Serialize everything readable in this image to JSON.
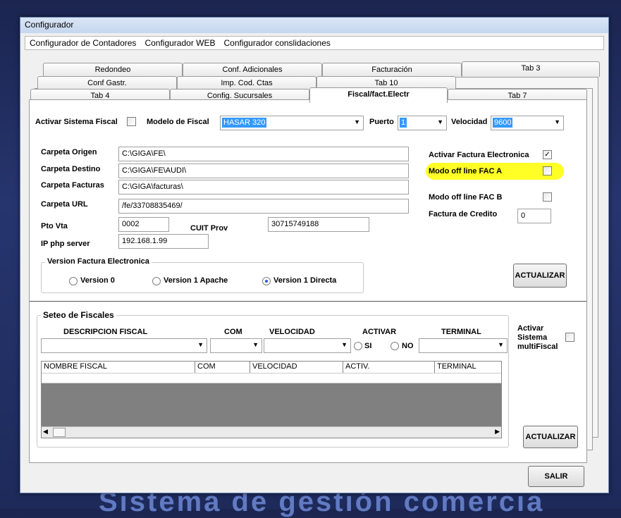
{
  "background_text": "Sistema de gestión comercia",
  "window": {
    "title": "Configurador"
  },
  "menu": [
    "Configurador de Contadores",
    "Configurador WEB",
    "Configurador conslidaciones"
  ],
  "tabs": {
    "row1": [
      "Redondeo",
      "Conf. Adicionales",
      "Facturación",
      "Tab 3"
    ],
    "row2": [
      "Conf Gastr.",
      "Imp. Cod. Ctas",
      "Tab 10"
    ],
    "row3": [
      "Tab 4",
      "Config. Sucursales",
      "Fiscal/fact.Electr",
      "Tab 7"
    ]
  },
  "fiscal": {
    "activar_label": "Activar Sistema Fiscal",
    "modelo_label": "Modelo de Fiscal",
    "modelo_value": "HASAR 320",
    "puerto_label": "Puerto",
    "puerto_value": "1",
    "velocidad_label": "Velocidad",
    "velocidad_value": "9600"
  },
  "fe": {
    "origen_label": "Carpeta Origen",
    "origen_value": "C:\\GIGA\\FE\\",
    "destino_label": "Carpeta Destino",
    "destino_value": "C:\\GIGA\\FE\\AUDI\\",
    "facturas_label": "Carpeta Facturas",
    "facturas_value": "C:\\GIGA\\facturas\\",
    "url_label": "Carpeta URL",
    "url_value": "/fe/33708835469/",
    "ptovta_label": "Pto Vta",
    "ptovta_value": "0002",
    "cuit_label": "CUIT Prov",
    "cuit_value": "30715749188",
    "ip_label": "IP php server",
    "ip_value": "192.168.1.99",
    "activar_fe_label": "Activar Factura Electronica",
    "activar_fe_checked": true,
    "offline_a_label": "Modo off line FAC A",
    "offline_b_label": "Modo off line FAC B",
    "credito_label": "Factura de Credito",
    "credito_value": "0",
    "actualizar_label": "ACTUALIZAR",
    "highlight_color": "#ffff00"
  },
  "version": {
    "title": "Version Factura Electronica",
    "options": [
      "Version 0",
      "Version 1 Apache",
      "Version 1 Directa"
    ],
    "selected": "Version 1 Directa"
  },
  "seteo": {
    "title": "Seteo de Fiscales",
    "headers": [
      "DESCRIPCION FISCAL",
      "COM",
      "VELOCIDAD",
      "ACTIVAR",
      "TERMINAL"
    ],
    "si_label": "SI",
    "no_label": "NO",
    "grid_columns": [
      "NOMBRE FISCAL",
      "COM",
      "VELOCIDAD",
      "ACTIV.",
      "TERMINAL"
    ],
    "multi_label_1": "Activar",
    "multi_label_2": "Sistema",
    "multi_label_3": "multiFiscal",
    "actualizar_label": "ACTUALIZAR"
  },
  "salir_label": "SALIR"
}
